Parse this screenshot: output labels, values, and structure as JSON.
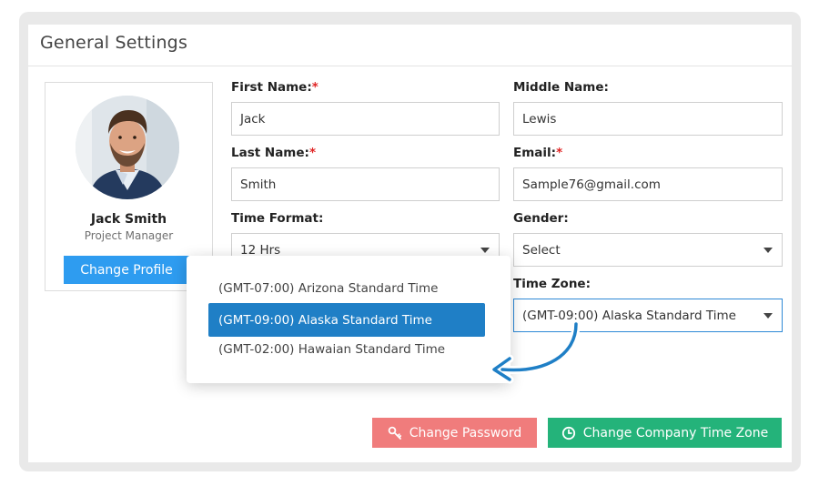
{
  "card": {
    "title": "General Settings"
  },
  "profile": {
    "name": "Jack Smith",
    "role": "Project Manager",
    "change_profile_label": "Change Profile"
  },
  "form": {
    "first_name": {
      "label": "First Name:",
      "required": "*",
      "value": "Jack"
    },
    "middle_name": {
      "label": "Middle Name:",
      "value": "Lewis"
    },
    "last_name": {
      "label": "Last Name:",
      "required": "*",
      "value": "Smith"
    },
    "email": {
      "label": "Email:",
      "required": "*",
      "value": "Sample76@gmail.com"
    },
    "time_format": {
      "label": "Time Format:",
      "value": "12 Hrs"
    },
    "gender": {
      "label": "Gender:",
      "value": "Select"
    },
    "time_zone": {
      "label": "Time Zone:",
      "value": "(GMT-09:00) Alaska Standard Time"
    }
  },
  "timezone_dropdown": {
    "options": [
      {
        "label": "(GMT-07:00) Arizona  Standard Time",
        "selected": false
      },
      {
        "label": "(GMT-09:00) Alaska Standard Time",
        "selected": true
      },
      {
        "label": "(GMT-02:00) Hawaian Standard Time",
        "selected": false
      }
    ]
  },
  "buttons": {
    "change_password": "Change Password",
    "change_company_time_zone": "Change Company Time Zone"
  },
  "icons": {
    "key": "key-icon",
    "clock": "clock-icon",
    "caret": "chevron-down-icon",
    "pointer": "curved-arrow-icon"
  },
  "colors": {
    "profile_button": "#2e9cf0",
    "selected_option": "#1f7fc6",
    "change_password_button": "#f07c7c",
    "change_time_zone_button": "#24b37a",
    "required_asterisk": "#e02424"
  }
}
